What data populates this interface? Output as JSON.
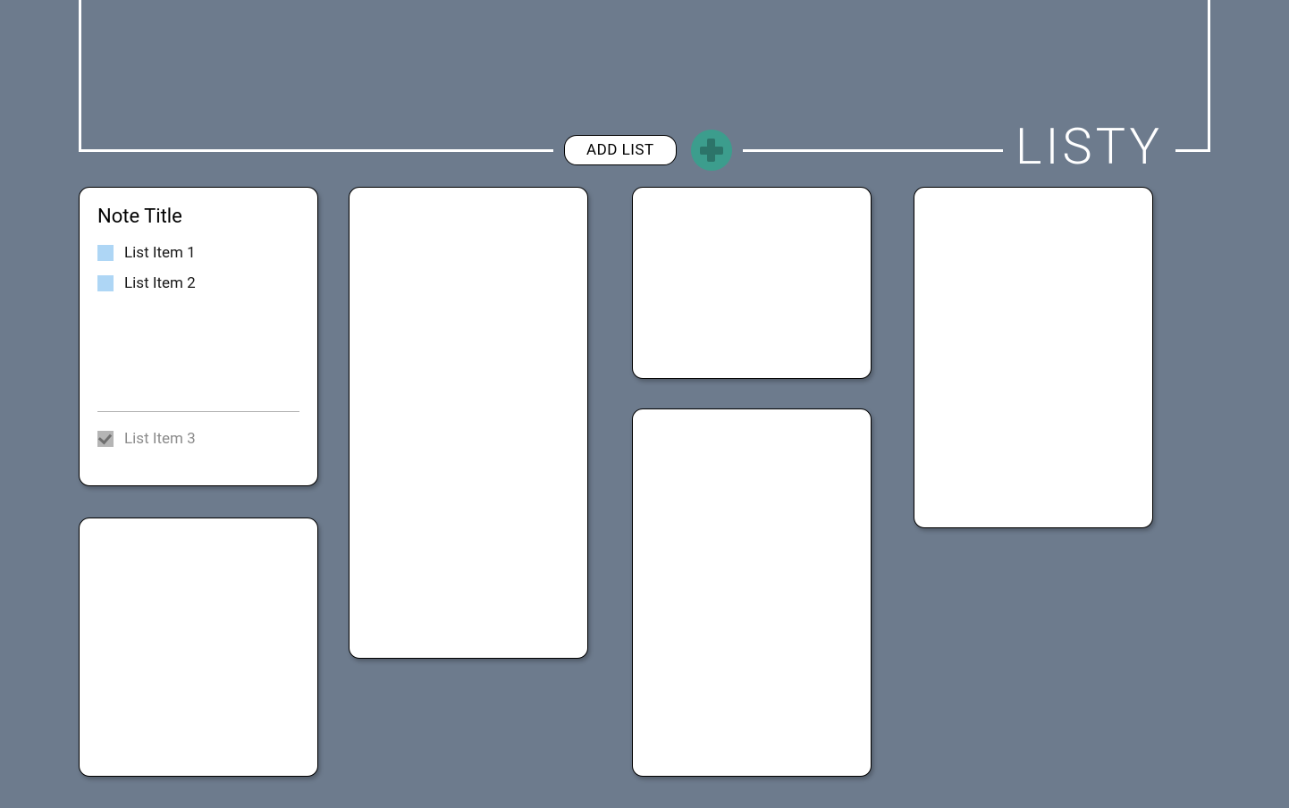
{
  "app": {
    "title": "LISTY",
    "add_button_label": "ADD LIST"
  },
  "cards": [
    {
      "title": "Note Title",
      "active_items": [
        {
          "label": "List Item 1",
          "done": false
        },
        {
          "label": "List Item 2",
          "done": false
        }
      ],
      "completed_items": [
        {
          "label": "List Item 3",
          "done": true
        }
      ]
    },
    {
      "title": "",
      "active_items": [],
      "completed_items": []
    },
    {
      "title": "",
      "active_items": [],
      "completed_items": []
    },
    {
      "title": "",
      "active_items": [],
      "completed_items": []
    },
    {
      "title": "",
      "active_items": [],
      "completed_items": []
    },
    {
      "title": "",
      "active_items": [],
      "completed_items": []
    }
  ],
  "colors": {
    "background": "#6d7b8d",
    "card_bg": "#ffffff",
    "accent": "#3c9d8d",
    "checkbox_active": "#aed6f5",
    "checkbox_done": "#b5b5b5"
  }
}
